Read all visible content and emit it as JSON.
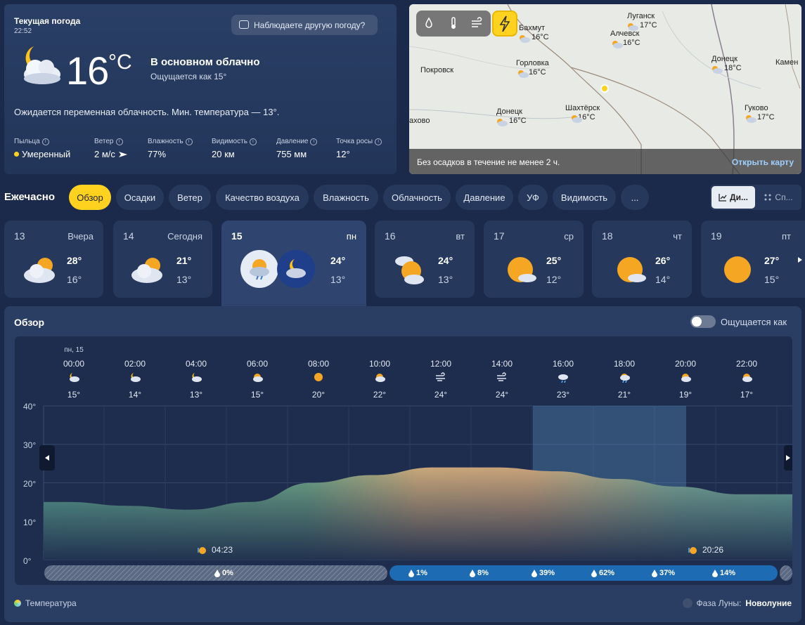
{
  "current": {
    "title": "Текущая погода",
    "time": "22:52",
    "observe_button": "Наблюдаете другую погоду?",
    "temp": "16",
    "unit": "°C",
    "condition": "В основном облачно",
    "feels_like": "Ощущается как   15°",
    "description": "Ожидается переменная облачность. Мин. температура — 13°.",
    "metrics": [
      {
        "label": "Пыльца",
        "value": "Умеренный"
      },
      {
        "label": "Ветер",
        "value": "2 м/с"
      },
      {
        "label": "Влажность",
        "value": "77%"
      },
      {
        "label": "Видимость",
        "value": "20 км"
      },
      {
        "label": "Давление",
        "value": "755 мм"
      },
      {
        "label": "Точка росы",
        "value": "12°"
      }
    ],
    "info_glyph": "i"
  },
  "map": {
    "cities": [
      {
        "name": "Бахмут",
        "temp": "16°C"
      },
      {
        "name": "Луганск",
        "temp": "17°C"
      },
      {
        "name": "Алчевск",
        "temp": "16°C"
      },
      {
        "name": "Покровск",
        "temp": ""
      },
      {
        "name": "Горловка",
        "temp": "16°C"
      },
      {
        "name": "Донецк",
        "temp": "18°C"
      },
      {
        "name": "Камен",
        "temp": ""
      },
      {
        "name": "Шахтёрск",
        "temp": "16°C"
      },
      {
        "name": "Донецк",
        "temp": "16°C"
      },
      {
        "name": "Гуково",
        "temp": "17°C"
      },
      {
        "name": "ахово",
        "temp": ""
      }
    ],
    "footer_text": "Без осадков в течение не менее 2 ч.",
    "open_map": "Открыть карту"
  },
  "hourly": {
    "title": "Ежечасно",
    "tabs": [
      "Обзор",
      "Осадки",
      "Ветер",
      "Качество воздуха",
      "Влажность",
      "Облачность",
      "Давление",
      "УФ",
      "Видимость",
      "..."
    ],
    "view_diagram": "Ди...",
    "view_list": "Сп..."
  },
  "days": [
    {
      "num": "13",
      "name": "Вчера",
      "max": "28°",
      "min": "16°"
    },
    {
      "num": "14",
      "name": "Сегодня",
      "max": "21°",
      "min": "13°"
    },
    {
      "num": "15",
      "name": "пн",
      "max": "24°",
      "min": "13°"
    },
    {
      "num": "16",
      "name": "вт",
      "max": "24°",
      "min": "13°"
    },
    {
      "num": "17",
      "name": "ср",
      "max": "25°",
      "min": "12°"
    },
    {
      "num": "18",
      "name": "чт",
      "max": "26°",
      "min": "14°"
    },
    {
      "num": "19",
      "name": "пт",
      "max": "27°",
      "min": "15°"
    }
  ],
  "overview": {
    "title": "Обзор",
    "feels_toggle": "Ощущается как",
    "date_label": "пн, 15",
    "legend_temp": "Температура",
    "moon_label": "Фаза Луны:",
    "moon_value": "Новолуние",
    "sunrise": "04:23",
    "sunset": "20:26"
  },
  "chart_data": {
    "type": "area",
    "x": [
      "00:00",
      "02:00",
      "04:00",
      "06:00",
      "08:00",
      "10:00",
      "12:00",
      "14:00",
      "16:00",
      "18:00",
      "20:00",
      "22:00"
    ],
    "hour_icons": [
      "night-cloudy",
      "night-cloudy",
      "night-cloudy",
      "sun-cloud",
      "sun",
      "sun-cloud",
      "wind",
      "wind",
      "rain",
      "rain-sun",
      "sun-cloud",
      "sun-cloud"
    ],
    "series": [
      {
        "values": [
          15,
          14,
          13,
          15,
          20,
          22,
          24,
          24,
          23,
          21,
          19,
          17
        ]
      }
    ],
    "y_ticks": [
      "40°",
      "30°",
      "20°",
      "10°",
      "0°"
    ],
    "ylim": [
      0,
      40
    ],
    "precipitation": [
      {
        "label": "0%"
      },
      {
        "label": "1%"
      },
      {
        "label": "8%"
      },
      {
        "label": "39%"
      },
      {
        "label": "62%"
      },
      {
        "label": "37%"
      },
      {
        "label": "14%"
      }
    ]
  }
}
